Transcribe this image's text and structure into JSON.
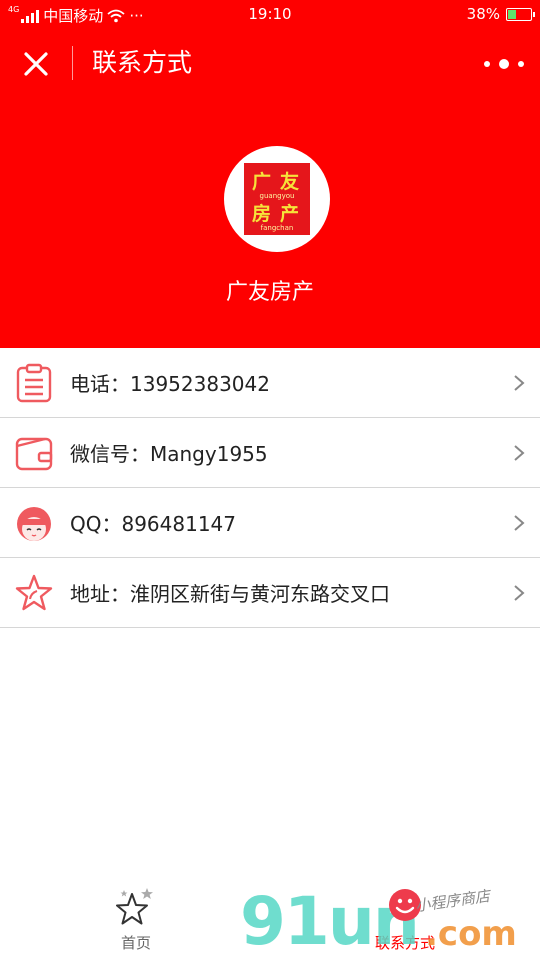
{
  "status_bar": {
    "network": "4G",
    "carrier": "中国移动",
    "extras": "···",
    "time": "19:10",
    "battery": "38%",
    "battery_level": 0.38
  },
  "nav": {
    "title": "联系方式"
  },
  "company": {
    "name": "广友房产",
    "logo": {
      "chars": [
        "广",
        "友",
        "房",
        "产"
      ],
      "pinyin_top": "guangyou",
      "pinyin_bottom": "fangchan"
    }
  },
  "contacts": [
    {
      "icon": "clipboard-icon",
      "text": "电话：13952383042"
    },
    {
      "icon": "wallet-icon",
      "text": "微信号：Mangy1955"
    },
    {
      "icon": "avatar-icon",
      "text": "QQ：896481147"
    },
    {
      "icon": "star-icon",
      "text": "地址：淮阴区新街与黄河东路交叉口"
    }
  ],
  "tabs": {
    "home": "首页",
    "contact": "联系方式"
  },
  "watermark": {
    "brand": "91un",
    "domain": ".com",
    "store": "小程序商店"
  },
  "colors": {
    "primary": "#fe0000",
    "icon_red": "#ef5a5f",
    "tab_active": "#fe0000"
  }
}
